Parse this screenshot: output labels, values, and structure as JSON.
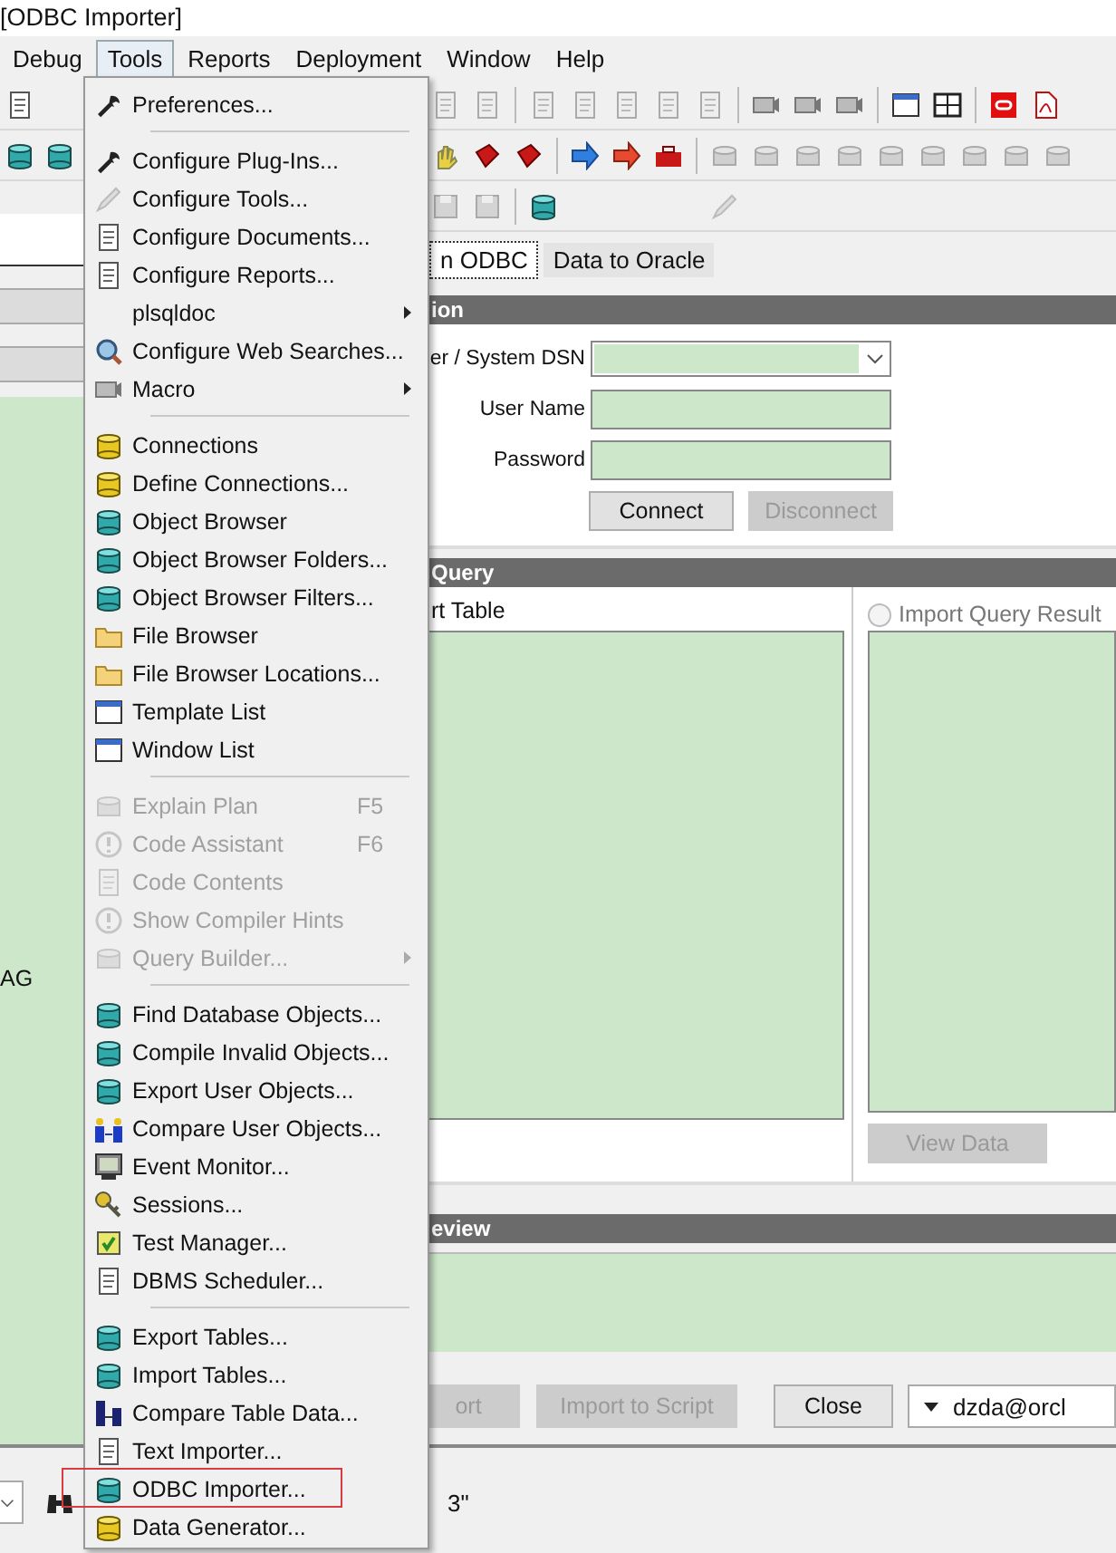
{
  "title_bar": {
    "title": "[ODBC Importer]"
  },
  "menu_bar": [
    {
      "label": "Debug",
      "selected": false
    },
    {
      "label": "Tools",
      "selected": true
    },
    {
      "label": "Reports",
      "selected": false
    },
    {
      "label": "Deployment",
      "selected": false
    },
    {
      "label": "Window",
      "selected": false
    },
    {
      "label": "Help",
      "selected": false
    }
  ],
  "tools_menu": {
    "items": [
      {
        "kind": "item",
        "label": "Preferences...",
        "disabled": false,
        "highlighted": false
      },
      {
        "kind": "separator"
      },
      {
        "kind": "item",
        "label": "Configure Plug-Ins...",
        "disabled": false,
        "highlighted": false
      },
      {
        "kind": "item",
        "label": "Configure Tools...",
        "disabled": false,
        "highlighted": false
      },
      {
        "kind": "item",
        "label": "Configure Documents...",
        "disabled": false,
        "highlighted": false
      },
      {
        "kind": "item",
        "label": "Configure Reports...",
        "disabled": false,
        "highlighted": false
      },
      {
        "kind": "submenu",
        "label": "plsqldoc",
        "disabled": false,
        "highlighted": false
      },
      {
        "kind": "item",
        "label": "Configure Web Searches...",
        "disabled": false,
        "highlighted": false
      },
      {
        "kind": "submenu",
        "label": "Macro",
        "disabled": false,
        "highlighted": false
      },
      {
        "kind": "separator"
      },
      {
        "kind": "item",
        "label": "Connections",
        "disabled": false,
        "highlighted": false
      },
      {
        "kind": "item",
        "label": "Define Connections...",
        "disabled": false,
        "highlighted": false
      },
      {
        "kind": "item",
        "label": "Object Browser",
        "disabled": false,
        "highlighted": false
      },
      {
        "kind": "item",
        "label": "Object Browser Folders...",
        "disabled": false,
        "highlighted": false
      },
      {
        "kind": "item",
        "label": "Object Browser Filters...",
        "disabled": false,
        "highlighted": false
      },
      {
        "kind": "item",
        "label": "File Browser",
        "disabled": false,
        "highlighted": false
      },
      {
        "kind": "item",
        "label": "File Browser Locations...",
        "disabled": false,
        "highlighted": false
      },
      {
        "kind": "item",
        "label": "Template List",
        "disabled": false,
        "highlighted": false
      },
      {
        "kind": "item",
        "label": "Window List",
        "disabled": false,
        "highlighted": false
      },
      {
        "kind": "separator"
      },
      {
        "kind": "item",
        "label": "Explain Plan",
        "shortcut": "F5",
        "disabled": true,
        "highlighted": false
      },
      {
        "kind": "item",
        "label": "Code Assistant",
        "shortcut": "F6",
        "disabled": true,
        "highlighted": false
      },
      {
        "kind": "item",
        "label": "Code Contents",
        "disabled": true,
        "highlighted": false
      },
      {
        "kind": "item",
        "label": "Show Compiler Hints",
        "disabled": true,
        "highlighted": false
      },
      {
        "kind": "submenu",
        "label": "Query Builder...",
        "disabled": true,
        "highlighted": false
      },
      {
        "kind": "separator"
      },
      {
        "kind": "item",
        "label": "Find Database Objects...",
        "disabled": false,
        "highlighted": false
      },
      {
        "kind": "item",
        "label": "Compile Invalid Objects...",
        "disabled": false,
        "highlighted": false
      },
      {
        "kind": "item",
        "label": "Export User Objects...",
        "disabled": false,
        "highlighted": false
      },
      {
        "kind": "item",
        "label": "Compare User Objects...",
        "disabled": false,
        "highlighted": false
      },
      {
        "kind": "item",
        "label": "Event Monitor...",
        "disabled": false,
        "highlighted": false
      },
      {
        "kind": "item",
        "label": "Sessions...",
        "disabled": false,
        "highlighted": false
      },
      {
        "kind": "item",
        "label": "Test Manager...",
        "disabled": false,
        "highlighted": false
      },
      {
        "kind": "item",
        "label": "DBMS Scheduler...",
        "disabled": false,
        "highlighted": false
      },
      {
        "kind": "separator"
      },
      {
        "kind": "item",
        "label": "Export Tables...",
        "disabled": false,
        "highlighted": false
      },
      {
        "kind": "item",
        "label": "Import Tables...",
        "disabled": false,
        "highlighted": false
      },
      {
        "kind": "item",
        "label": "Compare Table Data...",
        "disabled": false,
        "highlighted": false
      },
      {
        "kind": "item",
        "label": "Text Importer...",
        "disabled": false,
        "highlighted": false
      },
      {
        "kind": "item",
        "label": "ODBC Importer...",
        "disabled": false,
        "highlighted": true
      },
      {
        "kind": "item",
        "label": "Data Generator...",
        "disabled": false,
        "highlighted": false
      }
    ]
  },
  "left_panel": {
    "text": "AG"
  },
  "tabs": [
    {
      "label": "n ODBC",
      "selected": true
    },
    {
      "label": "Data to Oracle",
      "selected": false
    }
  ],
  "connection": {
    "header": "ion",
    "dsn_label": "er / System DSN",
    "user_label": "User Name",
    "password_label": "Password",
    "buttons": [
      {
        "label": "Connect",
        "disabled": false
      },
      {
        "label": "Disconnect",
        "disabled": true
      }
    ]
  },
  "query": {
    "header": "Query",
    "table_option": "rt Table",
    "result_option": {
      "label": "Import Query Result",
      "selected": false
    },
    "view_button": {
      "label": "View Data",
      "disabled": true
    }
  },
  "preview": {
    "header": "eview"
  },
  "actions": [
    {
      "label": "ort",
      "disabled": true
    },
    {
      "label": "Import to Script",
      "disabled": true
    },
    {
      "label": "Close",
      "disabled": false
    }
  ],
  "connection_select": {
    "value": "dzda@orcl"
  },
  "status_bar": {
    "text": "3\""
  }
}
